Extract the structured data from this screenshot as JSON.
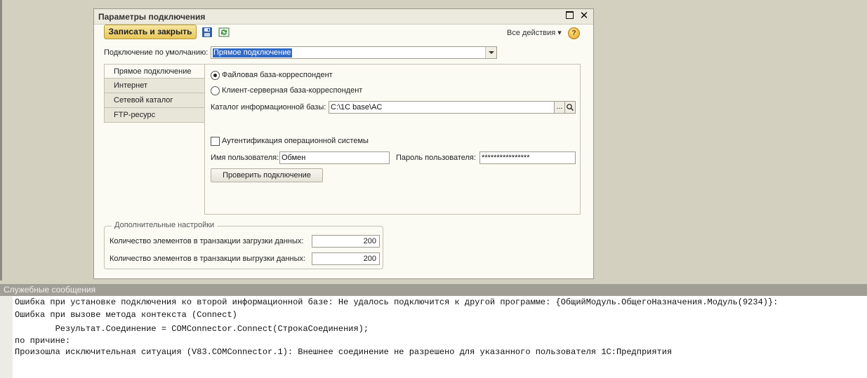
{
  "window": {
    "title": "Параметры подключения",
    "maximize_icon": "maximize-icon",
    "close_icon": "close-icon"
  },
  "toolbar": {
    "save_close_label": "Записать и закрыть",
    "save_icon": "floppy-disk-icon",
    "refresh_icon": "refresh-icon",
    "all_actions_label": "Все действия ▾",
    "help_label": "?"
  },
  "default_connection": {
    "label": "Подключение по умолчанию:",
    "value": "Прямое подключение"
  },
  "tabs": [
    {
      "label": "Прямое подключение",
      "active": true
    },
    {
      "label": "Интернет",
      "active": false
    },
    {
      "label": "Сетевой каталог",
      "active": false
    },
    {
      "label": "FTP-ресурс",
      "active": false
    }
  ],
  "direct_panel": {
    "radio_file": "Файловая база-корреспондент",
    "radio_server": "Клиент-серверная база-корреспондент",
    "catalog_label": "Каталог информационной базы:",
    "catalog_value": "C:\\1C base\\AC",
    "browse_label": "...",
    "os_auth_label": "Аутентификация операционной системы",
    "os_auth_checked": false,
    "username_label": "Имя пользователя:",
    "username_value": "Обмен",
    "password_label": "Пароль пользователя:",
    "password_value": "****************",
    "check_button_label": "Проверить подключение"
  },
  "extra_settings": {
    "title": "Дополнительные настройки",
    "load_label": "Количество элементов в транзакции загрузки данных:",
    "load_value": "200",
    "unload_label": "Количество элементов в транзакции выгрузки данных:",
    "unload_value": "200"
  },
  "messages": {
    "header": "Служебные сообщения",
    "lines": [
      "Ошибка при установке подключения ко второй информационной базе: Не удалось подключится к другой программе: {ОбщийМодуль.ОбщегоНазначения.Модуль(9234)}:",
      "Ошибка при вызове метода контекста (Connect)",
      "        Результат.Соединение = COMConnector.Connect(СтрокаСоединения);",
      "по причине:",
      "Произошла исключительная ситуация (V83.COMConnector.1): Внешнее соединение не разрешено для указанного пользователя 1С:Предприятия"
    ]
  },
  "colors": {
    "background": "#d4d0c0",
    "accent_button": "#e8c65a",
    "selection": "#316ac5",
    "messages_header": "#a19e96"
  }
}
